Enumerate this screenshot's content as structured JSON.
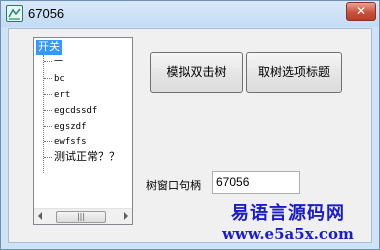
{
  "window": {
    "title": "67056",
    "close_glyph": "✕"
  },
  "tree": {
    "root": "开关",
    "items": [
      "一",
      "bc",
      "ert",
      "egcdssdf",
      "egszdf",
      "ewfsfs",
      "测试正常？？"
    ],
    "scroll_thumb_glyph": "|||"
  },
  "buttons": {
    "simulate_double_click": "模拟双击树",
    "fetch_selected_title": "取树选项标题"
  },
  "handle": {
    "label": "树窗口句柄",
    "value": "67056"
  },
  "watermark": {
    "name": "易语言源码网",
    "url": "www.e5a5x.com"
  },
  "colors": {
    "selection": "#3399ff",
    "watermark": "#1a1ad0",
    "frame": "#cfe3f7"
  },
  "icons": [
    "app-icon",
    "close-icon",
    "scroll-left-arrow-icon",
    "scroll-right-arrow-icon"
  ]
}
